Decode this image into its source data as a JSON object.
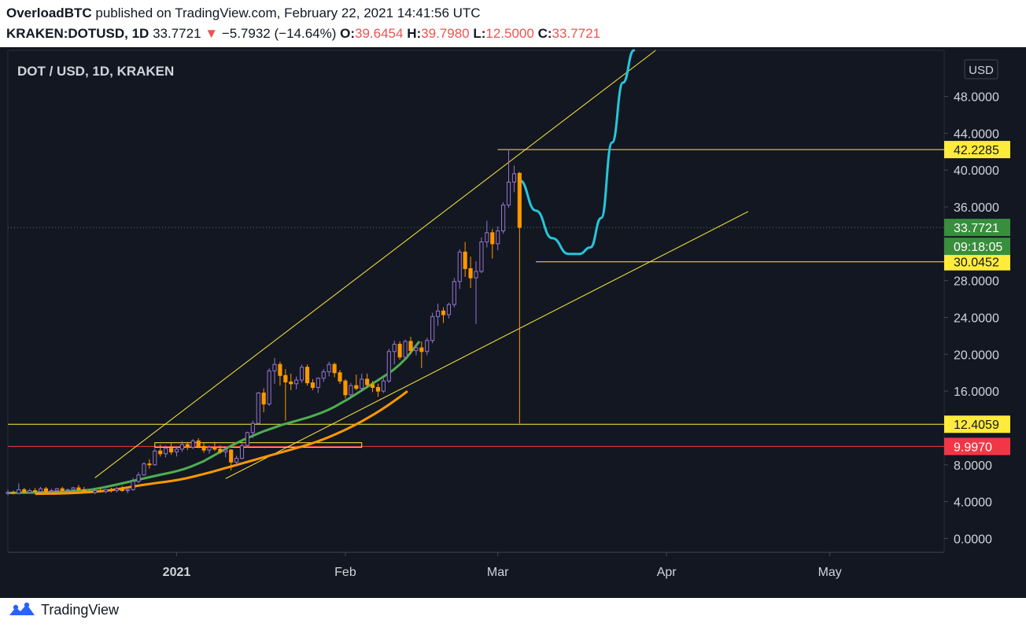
{
  "header": {
    "author": "OverloadBTC",
    "published_text": "published on TradingView.com, February 22, 2021 14:41:56 UTC",
    "symbol": "KRAKEN:DOTUSD, 1D",
    "last": "33.7721",
    "change_arrow": "▼",
    "change": "−5.7932 (−14.64%)",
    "o_label": "O:",
    "o": "39.6454",
    "h_label": "H:",
    "h": "39.7980",
    "l_label": "L:",
    "l": "12.5000",
    "c_label": "C:",
    "c": "33.7721"
  },
  "footer": {
    "brand": "TradingView",
    "logo_icon": "tradingview-logo-icon"
  },
  "chart_data": {
    "type": "candlestick",
    "title": "DOT / USD, 1D, KRAKEN",
    "currency_label": "USD",
    "ylim": [
      -1.5,
      53
    ],
    "y_ticks": [
      "0.0000",
      "4.0000",
      "8.0000",
      "16.0000",
      "20.0000",
      "24.0000",
      "28.0000",
      "36.0000",
      "40.0000",
      "44.0000",
      "48.0000"
    ],
    "x_labels": [
      "2021",
      "Feb",
      "Mar",
      "Apr",
      "May"
    ],
    "x_label_dates": [
      "2021-01-01",
      "2021-02-01",
      "2021-03-01",
      "2021-04-01",
      "2021-05-01"
    ],
    "xlim": [
      "2020-12-01",
      "2021-05-22"
    ],
    "colors": {
      "up": "#9575cd",
      "down": "#ff9800",
      "background": "#131722",
      "axis_text": "#d1d4dc"
    },
    "candles": [
      {
        "date": "2020-12-01",
        "o": 4.9,
        "h": 5.3,
        "l": 4.7,
        "c": 5.0
      },
      {
        "date": "2020-12-02",
        "o": 5.0,
        "h": 5.2,
        "l": 4.8,
        "c": 4.9
      },
      {
        "date": "2020-12-03",
        "o": 4.9,
        "h": 6.0,
        "l": 4.8,
        "c": 5.3
      },
      {
        "date": "2020-12-04",
        "o": 5.3,
        "h": 5.5,
        "l": 4.9,
        "c": 5.0
      },
      {
        "date": "2020-12-05",
        "o": 5.0,
        "h": 5.4,
        "l": 4.9,
        "c": 5.2
      },
      {
        "date": "2020-12-06",
        "o": 5.2,
        "h": 5.5,
        "l": 5.0,
        "c": 5.1
      },
      {
        "date": "2020-12-07",
        "o": 5.1,
        "h": 5.6,
        "l": 5.0,
        "c": 5.4
      },
      {
        "date": "2020-12-08",
        "o": 5.4,
        "h": 5.6,
        "l": 5.0,
        "c": 5.1
      },
      {
        "date": "2020-12-09",
        "o": 5.1,
        "h": 5.4,
        "l": 4.9,
        "c": 5.2
      },
      {
        "date": "2020-12-10",
        "o": 5.2,
        "h": 5.5,
        "l": 5.0,
        "c": 5.4
      },
      {
        "date": "2020-12-11",
        "o": 5.4,
        "h": 5.6,
        "l": 5.1,
        "c": 5.2
      },
      {
        "date": "2020-12-12",
        "o": 5.2,
        "h": 5.4,
        "l": 5.0,
        "c": 5.3
      },
      {
        "date": "2020-12-13",
        "o": 5.3,
        "h": 5.6,
        "l": 5.1,
        "c": 5.5
      },
      {
        "date": "2020-12-14",
        "o": 5.5,
        "h": 5.8,
        "l": 5.2,
        "c": 5.3
      },
      {
        "date": "2020-12-15",
        "o": 5.3,
        "h": 5.6,
        "l": 5.0,
        "c": 5.1
      },
      {
        "date": "2020-12-16",
        "o": 5.1,
        "h": 5.3,
        "l": 4.9,
        "c": 5.0
      },
      {
        "date": "2020-12-17",
        "o": 5.0,
        "h": 5.3,
        "l": 4.8,
        "c": 5.2
      },
      {
        "date": "2020-12-18",
        "o": 5.2,
        "h": 5.5,
        "l": 5.0,
        "c": 5.1
      },
      {
        "date": "2020-12-19",
        "o": 5.1,
        "h": 5.4,
        "l": 4.9,
        "c": 5.3
      },
      {
        "date": "2020-12-20",
        "o": 5.3,
        "h": 5.5,
        "l": 5.0,
        "c": 5.2
      },
      {
        "date": "2020-12-21",
        "o": 5.2,
        "h": 5.6,
        "l": 5.0,
        "c": 5.4
      },
      {
        "date": "2020-12-22",
        "o": 5.4,
        "h": 5.7,
        "l": 5.1,
        "c": 5.2
      },
      {
        "date": "2020-12-23",
        "o": 5.2,
        "h": 5.4,
        "l": 4.9,
        "c": 5.3
      },
      {
        "date": "2020-12-24",
        "o": 5.3,
        "h": 6.6,
        "l": 5.2,
        "c": 6.2
      },
      {
        "date": "2020-12-25",
        "o": 6.2,
        "h": 7.2,
        "l": 6.0,
        "c": 6.9
      },
      {
        "date": "2020-12-26",
        "o": 6.9,
        "h": 8.3,
        "l": 6.8,
        "c": 8.1
      },
      {
        "date": "2020-12-27",
        "o": 8.1,
        "h": 8.6,
        "l": 7.6,
        "c": 8.0
      },
      {
        "date": "2020-12-28",
        "o": 8.0,
        "h": 9.8,
        "l": 7.9,
        "c": 9.5
      },
      {
        "date": "2020-12-29",
        "o": 9.5,
        "h": 10.2,
        "l": 8.9,
        "c": 9.2
      },
      {
        "date": "2020-12-30",
        "o": 9.2,
        "h": 10.1,
        "l": 8.8,
        "c": 9.8
      },
      {
        "date": "2020-12-31",
        "o": 9.8,
        "h": 10.4,
        "l": 9.1,
        "c": 9.4
      },
      {
        "date": "2021-01-01",
        "o": 9.4,
        "h": 10.0,
        "l": 8.9,
        "c": 9.7
      },
      {
        "date": "2021-01-02",
        "o": 9.7,
        "h": 10.6,
        "l": 9.4,
        "c": 10.2
      },
      {
        "date": "2021-01-03",
        "o": 10.2,
        "h": 10.5,
        "l": 9.6,
        "c": 9.9
      },
      {
        "date": "2021-01-04",
        "o": 9.9,
        "h": 10.8,
        "l": 9.7,
        "c": 10.6
      },
      {
        "date": "2021-01-05",
        "o": 10.6,
        "h": 10.9,
        "l": 9.8,
        "c": 10.0
      },
      {
        "date": "2021-01-06",
        "o": 10.0,
        "h": 10.4,
        "l": 9.3,
        "c": 9.6
      },
      {
        "date": "2021-01-07",
        "o": 9.6,
        "h": 10.1,
        "l": 9.2,
        "c": 9.9
      },
      {
        "date": "2021-01-08",
        "o": 9.9,
        "h": 10.5,
        "l": 9.5,
        "c": 9.7
      },
      {
        "date": "2021-01-09",
        "o": 9.7,
        "h": 10.1,
        "l": 9.2,
        "c": 9.4
      },
      {
        "date": "2021-01-10",
        "o": 9.4,
        "h": 9.9,
        "l": 8.8,
        "c": 9.6
      },
      {
        "date": "2021-01-11",
        "o": 9.6,
        "h": 9.7,
        "l": 7.4,
        "c": 8.3
      },
      {
        "date": "2021-01-12",
        "o": 8.3,
        "h": 9.0,
        "l": 7.8,
        "c": 8.7
      },
      {
        "date": "2021-01-13",
        "o": 8.7,
        "h": 10.3,
        "l": 8.6,
        "c": 10.1
      },
      {
        "date": "2021-01-14",
        "o": 10.1,
        "h": 11.6,
        "l": 9.9,
        "c": 11.5
      },
      {
        "date": "2021-01-15",
        "o": 11.5,
        "h": 12.8,
        "l": 10.9,
        "c": 12.5
      },
      {
        "date": "2021-01-16",
        "o": 12.5,
        "h": 15.9,
        "l": 12.4,
        "c": 15.8
      },
      {
        "date": "2021-01-17",
        "o": 15.8,
        "h": 16.3,
        "l": 13.7,
        "c": 14.6
      },
      {
        "date": "2021-01-18",
        "o": 14.6,
        "h": 18.5,
        "l": 14.4,
        "c": 18.2
      },
      {
        "date": "2021-01-19",
        "o": 18.2,
        "h": 19.6,
        "l": 16.8,
        "c": 18.9
      },
      {
        "date": "2021-01-20",
        "o": 18.9,
        "h": 19.2,
        "l": 16.6,
        "c": 17.7
      },
      {
        "date": "2021-01-21",
        "o": 17.7,
        "h": 18.4,
        "l": 12.8,
        "c": 17.0
      },
      {
        "date": "2021-01-22",
        "o": 17.0,
        "h": 17.9,
        "l": 16.1,
        "c": 16.8
      },
      {
        "date": "2021-01-23",
        "o": 16.8,
        "h": 17.6,
        "l": 16.2,
        "c": 17.2
      },
      {
        "date": "2021-01-24",
        "o": 17.2,
        "h": 18.9,
        "l": 16.9,
        "c": 18.6
      },
      {
        "date": "2021-01-25",
        "o": 18.6,
        "h": 18.9,
        "l": 16.6,
        "c": 16.9
      },
      {
        "date": "2021-01-26",
        "o": 16.9,
        "h": 17.3,
        "l": 16.1,
        "c": 16.4
      },
      {
        "date": "2021-01-27",
        "o": 16.4,
        "h": 17.5,
        "l": 15.8,
        "c": 17.4
      },
      {
        "date": "2021-01-28",
        "o": 17.4,
        "h": 18.4,
        "l": 17.0,
        "c": 18.1
      },
      {
        "date": "2021-01-29",
        "o": 18.1,
        "h": 19.2,
        "l": 17.6,
        "c": 18.9
      },
      {
        "date": "2021-01-30",
        "o": 18.9,
        "h": 19.1,
        "l": 17.5,
        "c": 18.0
      },
      {
        "date": "2021-01-31",
        "o": 18.0,
        "h": 18.3,
        "l": 16.8,
        "c": 17.1
      },
      {
        "date": "2021-02-01",
        "o": 17.1,
        "h": 17.3,
        "l": 15.2,
        "c": 15.6
      },
      {
        "date": "2021-02-02",
        "o": 15.6,
        "h": 16.9,
        "l": 15.3,
        "c": 16.6
      },
      {
        "date": "2021-02-03",
        "o": 16.6,
        "h": 17.8,
        "l": 16.1,
        "c": 16.3
      },
      {
        "date": "2021-02-04",
        "o": 16.3,
        "h": 17.9,
        "l": 16.0,
        "c": 17.3
      },
      {
        "date": "2021-02-05",
        "o": 17.3,
        "h": 17.9,
        "l": 16.4,
        "c": 16.7
      },
      {
        "date": "2021-02-06",
        "o": 16.7,
        "h": 17.1,
        "l": 15.9,
        "c": 16.4
      },
      {
        "date": "2021-02-07",
        "o": 16.4,
        "h": 16.8,
        "l": 15.4,
        "c": 16.0
      },
      {
        "date": "2021-02-08",
        "o": 16.0,
        "h": 17.4,
        "l": 15.8,
        "c": 17.1
      },
      {
        "date": "2021-02-09",
        "o": 17.1,
        "h": 20.6,
        "l": 16.9,
        "c": 20.3
      },
      {
        "date": "2021-02-10",
        "o": 20.3,
        "h": 21.5,
        "l": 18.9,
        "c": 21.1
      },
      {
        "date": "2021-02-11",
        "o": 21.1,
        "h": 21.4,
        "l": 19.4,
        "c": 19.7
      },
      {
        "date": "2021-02-12",
        "o": 19.7,
        "h": 21.6,
        "l": 19.5,
        "c": 21.4
      },
      {
        "date": "2021-02-13",
        "o": 21.4,
        "h": 21.9,
        "l": 20.0,
        "c": 20.4
      },
      {
        "date": "2021-02-14",
        "o": 20.4,
        "h": 21.0,
        "l": 19.9,
        "c": 20.7
      },
      {
        "date": "2021-02-15",
        "o": 20.7,
        "h": 21.4,
        "l": 18.5,
        "c": 20.3
      },
      {
        "date": "2021-02-16",
        "o": 20.3,
        "h": 21.8,
        "l": 19.9,
        "c": 21.5
      },
      {
        "date": "2021-02-17",
        "o": 21.5,
        "h": 24.5,
        "l": 21.2,
        "c": 24.1
      },
      {
        "date": "2021-02-18",
        "o": 24.1,
        "h": 25.5,
        "l": 23.1,
        "c": 24.7
      },
      {
        "date": "2021-02-19",
        "o": 24.7,
        "h": 25.1,
        "l": 23.4,
        "c": 24.3
      },
      {
        "date": "2021-02-20",
        "o": 24.3,
        "h": 25.6,
        "l": 23.9,
        "c": 25.4
      },
      {
        "date": "2021-02-21",
        "o": 25.4,
        "h": 28.3,
        "l": 25.1,
        "c": 27.9
      },
      {
        "date": "2021-02-22",
        "o": 27.9,
        "h": 31.4,
        "l": 27.1,
        "c": 31.1
      },
      {
        "date": "2021-02-23",
        "o": 31.1,
        "h": 32.2,
        "l": 28.4,
        "c": 29.3
      },
      {
        "date": "2021-02-24",
        "o": 29.3,
        "h": 30.6,
        "l": 27.2,
        "c": 28.3
      },
      {
        "date": "2021-02-25",
        "o": 28.3,
        "h": 30.1,
        "l": 23.3,
        "c": 29.0
      },
      {
        "date": "2021-02-26",
        "o": 29.0,
        "h": 32.7,
        "l": 28.8,
        "c": 32.2
      },
      {
        "date": "2021-02-27",
        "o": 32.2,
        "h": 34.5,
        "l": 31.6,
        "c": 33.2
      },
      {
        "date": "2021-02-28",
        "o": 33.2,
        "h": 33.6,
        "l": 30.4,
        "c": 32.0
      },
      {
        "date": "2021-03-01",
        "o": 32.0,
        "h": 33.9,
        "l": 31.3,
        "c": 33.4
      },
      {
        "date": "2021-03-02",
        "o": 33.4,
        "h": 36.5,
        "l": 33.1,
        "c": 36.2
      },
      {
        "date": "2021-03-03",
        "o": 36.2,
        "h": 42.23,
        "l": 35.9,
        "c": 38.7
      },
      {
        "date": "2021-03-04",
        "o": 38.7,
        "h": 40.5,
        "l": 37.6,
        "c": 39.6
      },
      {
        "date": "2021-03-05",
        "o": 39.6454,
        "h": 39.798,
        "l": 12.5,
        "c": 33.7721
      }
    ],
    "moving_averages": [
      {
        "name": "",
        "color": "#4caf50",
        "values": [
          4.95,
          4.96,
          4.97,
          4.98,
          4.99,
          5.0,
          5.02,
          5.04,
          5.06,
          5.09,
          5.13,
          5.18,
          5.25,
          5.34,
          5.46,
          5.6,
          5.75,
          5.91,
          6.07,
          6.23,
          6.39,
          6.55,
          6.71,
          6.87,
          7.02,
          7.17,
          7.35,
          7.55,
          7.8,
          8.1,
          8.4,
          8.8,
          9.2,
          9.6,
          10.0,
          10.35,
          10.7,
          11.0,
          11.3,
          11.6,
          11.85,
          12.1,
          12.35,
          12.55,
          12.75,
          12.95,
          13.15,
          13.4,
          13.65,
          13.95,
          14.3,
          14.7,
          15.1,
          15.55,
          16.0,
          16.45,
          16.9,
          17.35,
          17.8,
          18.3,
          18.9,
          19.6,
          20.5,
          21.4
        ]
      },
      {
        "name": "",
        "color": "#ff9800",
        "values": [
          4.85,
          4.86,
          4.87,
          4.88,
          4.9,
          4.92,
          4.95,
          4.98,
          5.02,
          5.07,
          5.13,
          5.2,
          5.29,
          5.4,
          5.52,
          5.64,
          5.76,
          5.87,
          5.97,
          6.07,
          6.16,
          6.26,
          6.38,
          6.52,
          6.68,
          6.86,
          7.04,
          7.22,
          7.42,
          7.62,
          7.82,
          8.02,
          8.22,
          8.42,
          8.62,
          8.82,
          9.02,
          9.22,
          9.42,
          9.62,
          9.82,
          10.02,
          10.24,
          10.48,
          10.74,
          11.02,
          11.32,
          11.64,
          11.98,
          12.34,
          12.72,
          13.12,
          13.54,
          13.98,
          14.45,
          14.95,
          15.45,
          16.0
        ]
      }
    ],
    "ma_start_dates": [
      "2020-12-01",
      "2020-12-06"
    ],
    "levels": [
      {
        "value": 42.2285,
        "label": "42.2285",
        "color": "#ffeb3b",
        "text_color": "#131722"
      },
      {
        "value": 30.0452,
        "label": "30.0452",
        "color": "#ffeb3b",
        "text_color": "#131722"
      },
      {
        "value": 12.4059,
        "label": "12.4059",
        "color": "#ffeb3b",
        "text_color": "#131722"
      },
      {
        "value": 9.997,
        "label": "9.9970",
        "color": "#f23645",
        "text_color": "#ffffff"
      }
    ],
    "last_price": {
      "value": 33.7721,
      "label": "33.7721",
      "countdown": "09:18:05",
      "color": "#388e3c"
    },
    "trendlines": [
      {
        "from": [
          "2020-12-17",
          6.6
        ],
        "to": [
          "2021-03-30",
          53
        ]
      },
      {
        "from": [
          "2021-01-10",
          6.5
        ],
        "to": [
          "2021-04-16",
          35.5
        ]
      }
    ],
    "range_box": {
      "from": [
        "2020-12-28",
        10.4
      ],
      "to": [
        "2021-02-04",
        9.9
      ]
    },
    "projection": {
      "color": "#26c6da",
      "points": [
        [
          "2021-03-05",
          38.9
        ],
        [
          "2021-03-08",
          35.6
        ],
        [
          "2021-03-11",
          32.6
        ],
        [
          "2021-03-14",
          30.9
        ],
        [
          "2021-03-16",
          30.9
        ],
        [
          "2021-03-18",
          31.6
        ],
        [
          "2021-03-20",
          34.8
        ],
        [
          "2021-03-22",
          43
        ],
        [
          "2021-03-24",
          49.5
        ],
        [
          "2021-03-26",
          53
        ]
      ]
    }
  }
}
